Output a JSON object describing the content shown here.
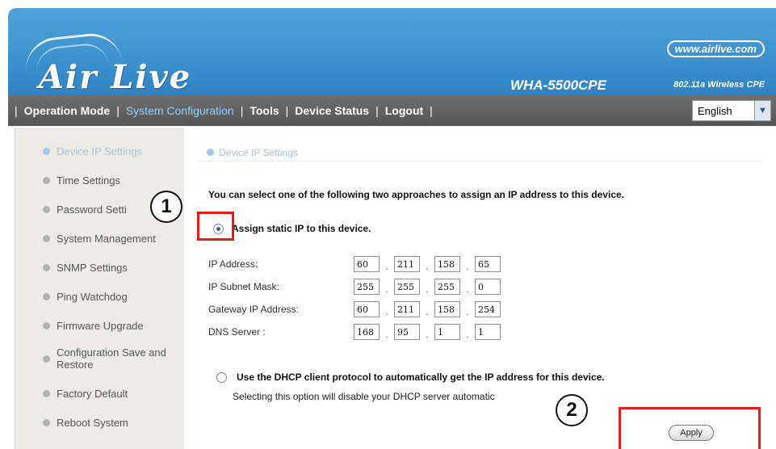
{
  "header": {
    "logo_text": "Air Live",
    "url": "www.airlive.com",
    "model": "WHA-5500CPE",
    "model_desc": "802.11a Wireless CPE"
  },
  "nav": {
    "items": [
      "Operation Mode",
      "System Configuration",
      "Tools",
      "Device Status",
      "Logout"
    ],
    "active": "System Configuration",
    "language": "English"
  },
  "sidebar": {
    "items": [
      {
        "label": "Device IP Settings",
        "active": true
      },
      {
        "label": "Time Settings"
      },
      {
        "label": "Password Setti"
      },
      {
        "label": "System Management"
      },
      {
        "label": "SNMP Settings"
      },
      {
        "label": "Ping Watchdog"
      },
      {
        "label": "Firmware Upgrade"
      },
      {
        "label": "Configuration Save and Restore"
      },
      {
        "label": "Factory Default"
      },
      {
        "label": "Reboot System"
      }
    ]
  },
  "content": {
    "title": "Device IP Settings",
    "intro": "You can select one of the following two approaches to assign an IP address to this device.",
    "option_static": "Assign static IP to this device.",
    "fields": [
      {
        "label": "IP Address:",
        "octets": [
          "60",
          "211",
          "158",
          "65"
        ]
      },
      {
        "label": "IP Subnet Mask:",
        "octets": [
          "255",
          "255",
          "255",
          "0"
        ]
      },
      {
        "label": "Gateway IP Address:",
        "octets": [
          "60",
          "211",
          "158",
          "254"
        ]
      },
      {
        "label": "DNS Server :",
        "octets": [
          "168",
          "95",
          "1",
          "1"
        ]
      }
    ],
    "option_dhcp": "Use the DHCP client protocol to automatically get the IP address for this device.",
    "dhcp_note": "Selecting this option will disable your DHCP server automatic",
    "apply_label": "Apply"
  },
  "annotations": {
    "callout_1": "1",
    "callout_2": "2",
    "highlight_color": "#e41b17"
  }
}
